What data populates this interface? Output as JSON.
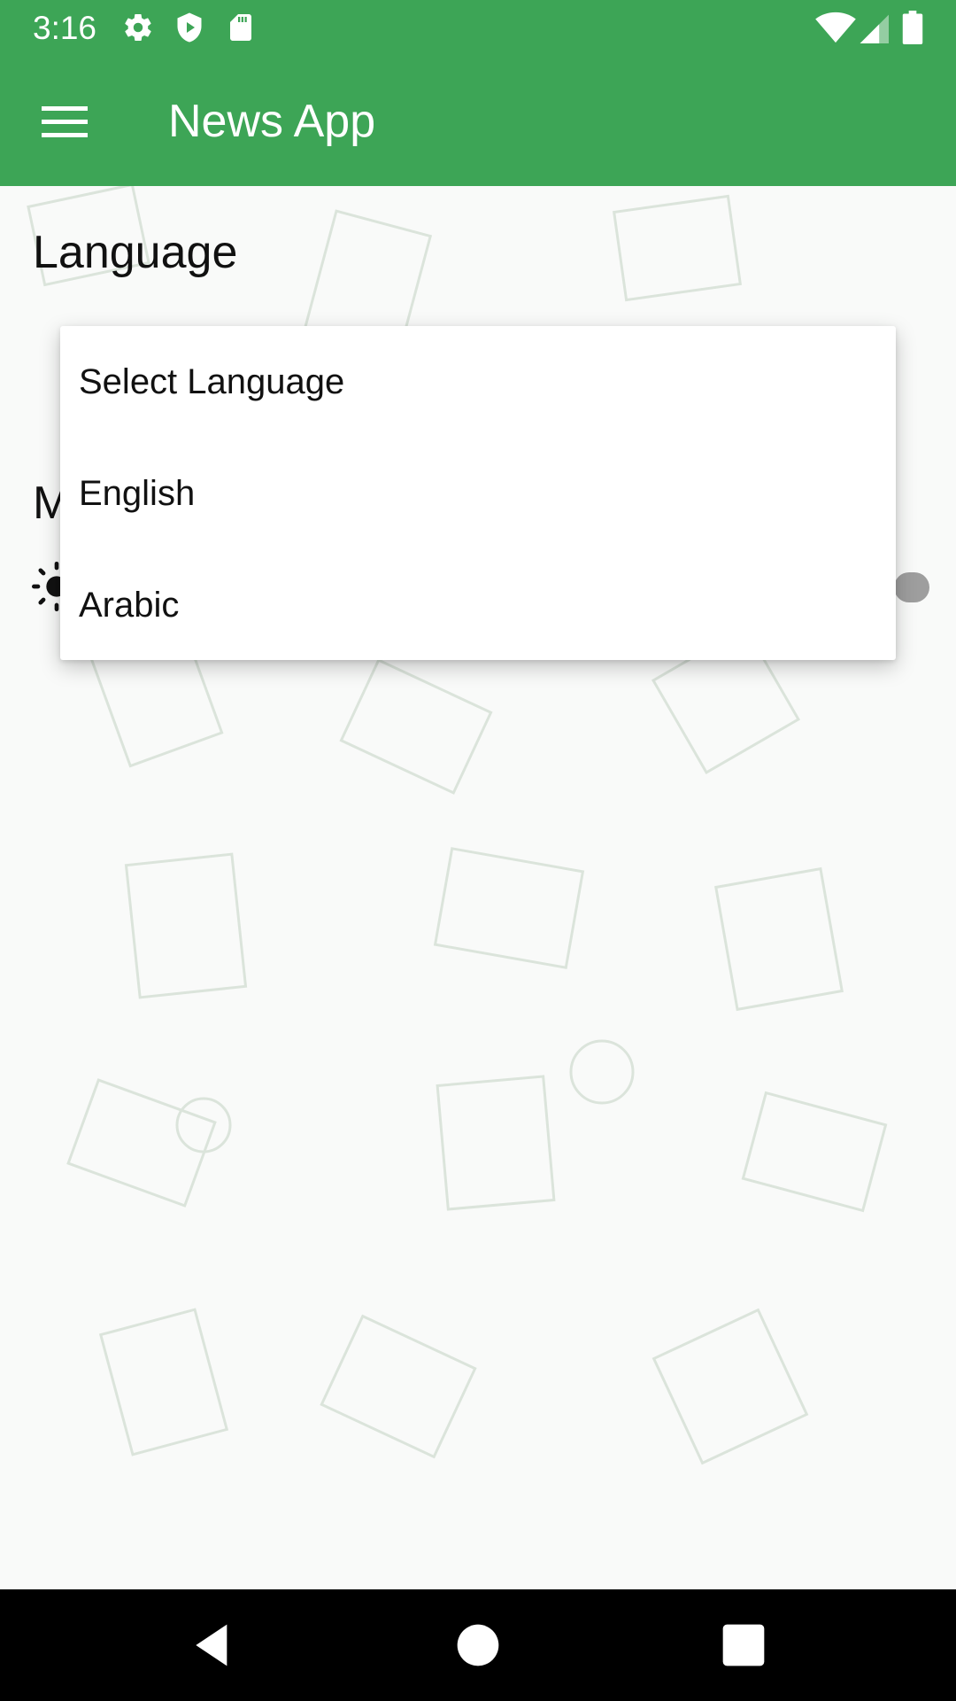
{
  "status_bar": {
    "time": "3:16",
    "left_icons": [
      "gear-icon",
      "shield-icon",
      "sd-card-icon"
    ],
    "right_icons": [
      "wifi-icon",
      "signal-icon",
      "battery-icon"
    ]
  },
  "app_bar": {
    "title": "News App",
    "menu_icon": "hamburger-menu-icon",
    "color": "#3da556"
  },
  "settings": {
    "language_title": "Language",
    "mode_title": "M",
    "mode_icon": "sun-icon"
  },
  "dropdown": {
    "items": [
      {
        "label": "Select Language"
      },
      {
        "label": "English"
      },
      {
        "label": "Arabic"
      }
    ]
  },
  "nav_bar": {
    "buttons": [
      "back-icon",
      "home-icon",
      "recents-icon"
    ]
  }
}
